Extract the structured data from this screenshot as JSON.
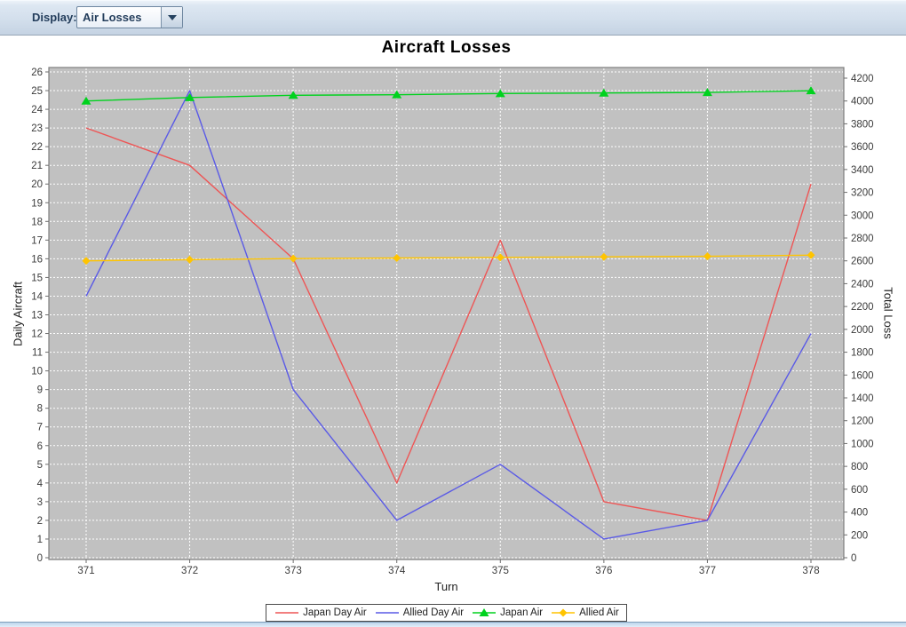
{
  "toolbar": {
    "display_label": "Display:",
    "display_select": {
      "value": "Air Losses"
    }
  },
  "chart": {
    "title": "Aircraft Losses"
  },
  "chart_data": {
    "type": "line",
    "title": "Aircraft Losses",
    "xlabel": "Turn",
    "ylabel_left": "Daily Aircraft",
    "ylabel_right": "Total Loss",
    "x": [
      371,
      372,
      373,
      374,
      375,
      376,
      377,
      378
    ],
    "ylim_left": [
      0,
      26
    ],
    "ytick_step_left": 1,
    "ylim_right": [
      0,
      4200
    ],
    "ytick_step_right": 200,
    "grid": true,
    "legend_position": "bottom",
    "plot_bg": "#c1c1c1",
    "grid_color": "#ffffff",
    "tick_label_color": "#3b3b3b",
    "axis_line_color": "#7e7e7e",
    "series": [
      {
        "name": "Japan Day Air",
        "axis": "left",
        "color": "#ee5555",
        "marker": "none",
        "values": [
          23,
          21,
          16,
          4,
          17,
          3,
          2,
          20
        ]
      },
      {
        "name": "Allied Day Air",
        "axis": "left",
        "color": "#5a5ae6",
        "marker": "none",
        "values": [
          14,
          25,
          9,
          2,
          5,
          1,
          2,
          12
        ]
      },
      {
        "name": "Japan Air",
        "axis": "right",
        "color": "#00d21e",
        "marker": "triangle",
        "values": [
          4000,
          4030,
          4050,
          4055,
          4065,
          4070,
          4075,
          4090
        ]
      },
      {
        "name": "Allied Air",
        "axis": "right",
        "color": "#ffc400",
        "marker": "diamond",
        "values": [
          2600,
          2610,
          2620,
          2625,
          2630,
          2635,
          2640,
          2650
        ]
      }
    ]
  }
}
